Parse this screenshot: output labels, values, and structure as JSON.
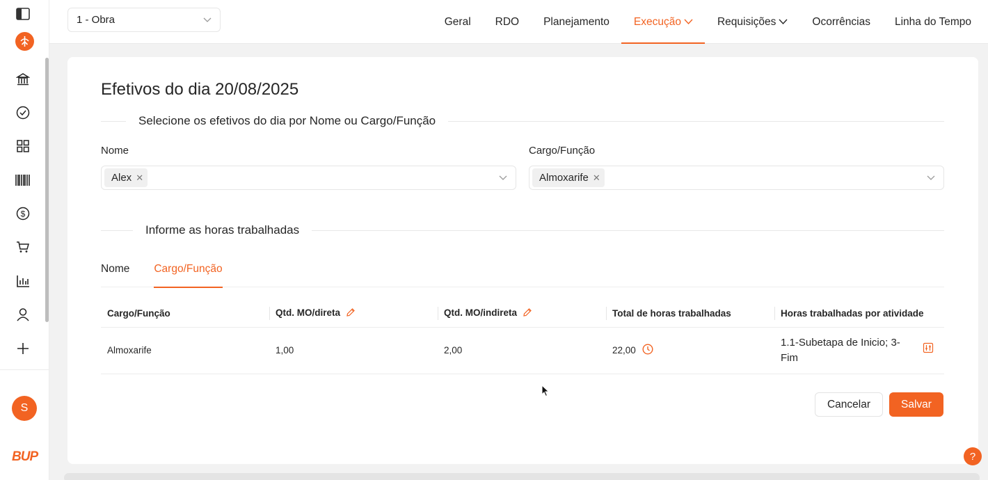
{
  "sidebar": {
    "icons": [
      "sidebar-toggle-icon",
      "company-logo-icon",
      "bank-icon",
      "check-circle-icon",
      "grid-icon",
      "barcode-icon",
      "dollar-icon",
      "cart-icon",
      "bar-chart-icon",
      "user-icon",
      "plus-icon"
    ],
    "avatar_initial": "S",
    "brand": "BUP"
  },
  "topbar": {
    "obra_select": "1 - Obra",
    "nav": [
      {
        "label": "Geral",
        "active": false
      },
      {
        "label": "RDO",
        "active": false
      },
      {
        "label": "Planejamento",
        "active": false
      },
      {
        "label": "Execução",
        "active": true,
        "dropdown": true
      },
      {
        "label": "Requisições",
        "active": false,
        "dropdown": true
      },
      {
        "label": "Ocorrências",
        "active": false
      },
      {
        "label": "Linha do Tempo",
        "active": false
      }
    ]
  },
  "main": {
    "title": "Efetivos do dia 20/08/2025",
    "section1": "Selecione os efetivos do dia por Nome ou Cargo/Função",
    "nome_label": "Nome",
    "nome_tag": "Alex",
    "cargo_label": "Cargo/Função",
    "cargo_tag": "Almoxarife",
    "section2": "Informe as horas trabalhadas",
    "tabs": [
      {
        "label": "Nome",
        "active": false
      },
      {
        "label": "Cargo/Função",
        "active": true
      }
    ],
    "table": {
      "headers": [
        "Cargo/Função",
        "Qtd. MO/direta",
        "Qtd. MO/indireta",
        "Total de horas trabalhadas",
        "Horas trabalhadas por atividade"
      ],
      "rows": [
        {
          "cargo": "Almoxarife",
          "mo_direta": "1,00",
          "mo_indireta": "2,00",
          "total_horas": "22,00",
          "atividades": "1.1-Subetapa de Inicio; 3-Fim"
        }
      ]
    },
    "buttons": {
      "cancel": "Cancelar",
      "save": "Salvar"
    }
  },
  "colors": {
    "accent": "#f26322",
    "text": "#262626",
    "background": "#f2f2f2"
  }
}
